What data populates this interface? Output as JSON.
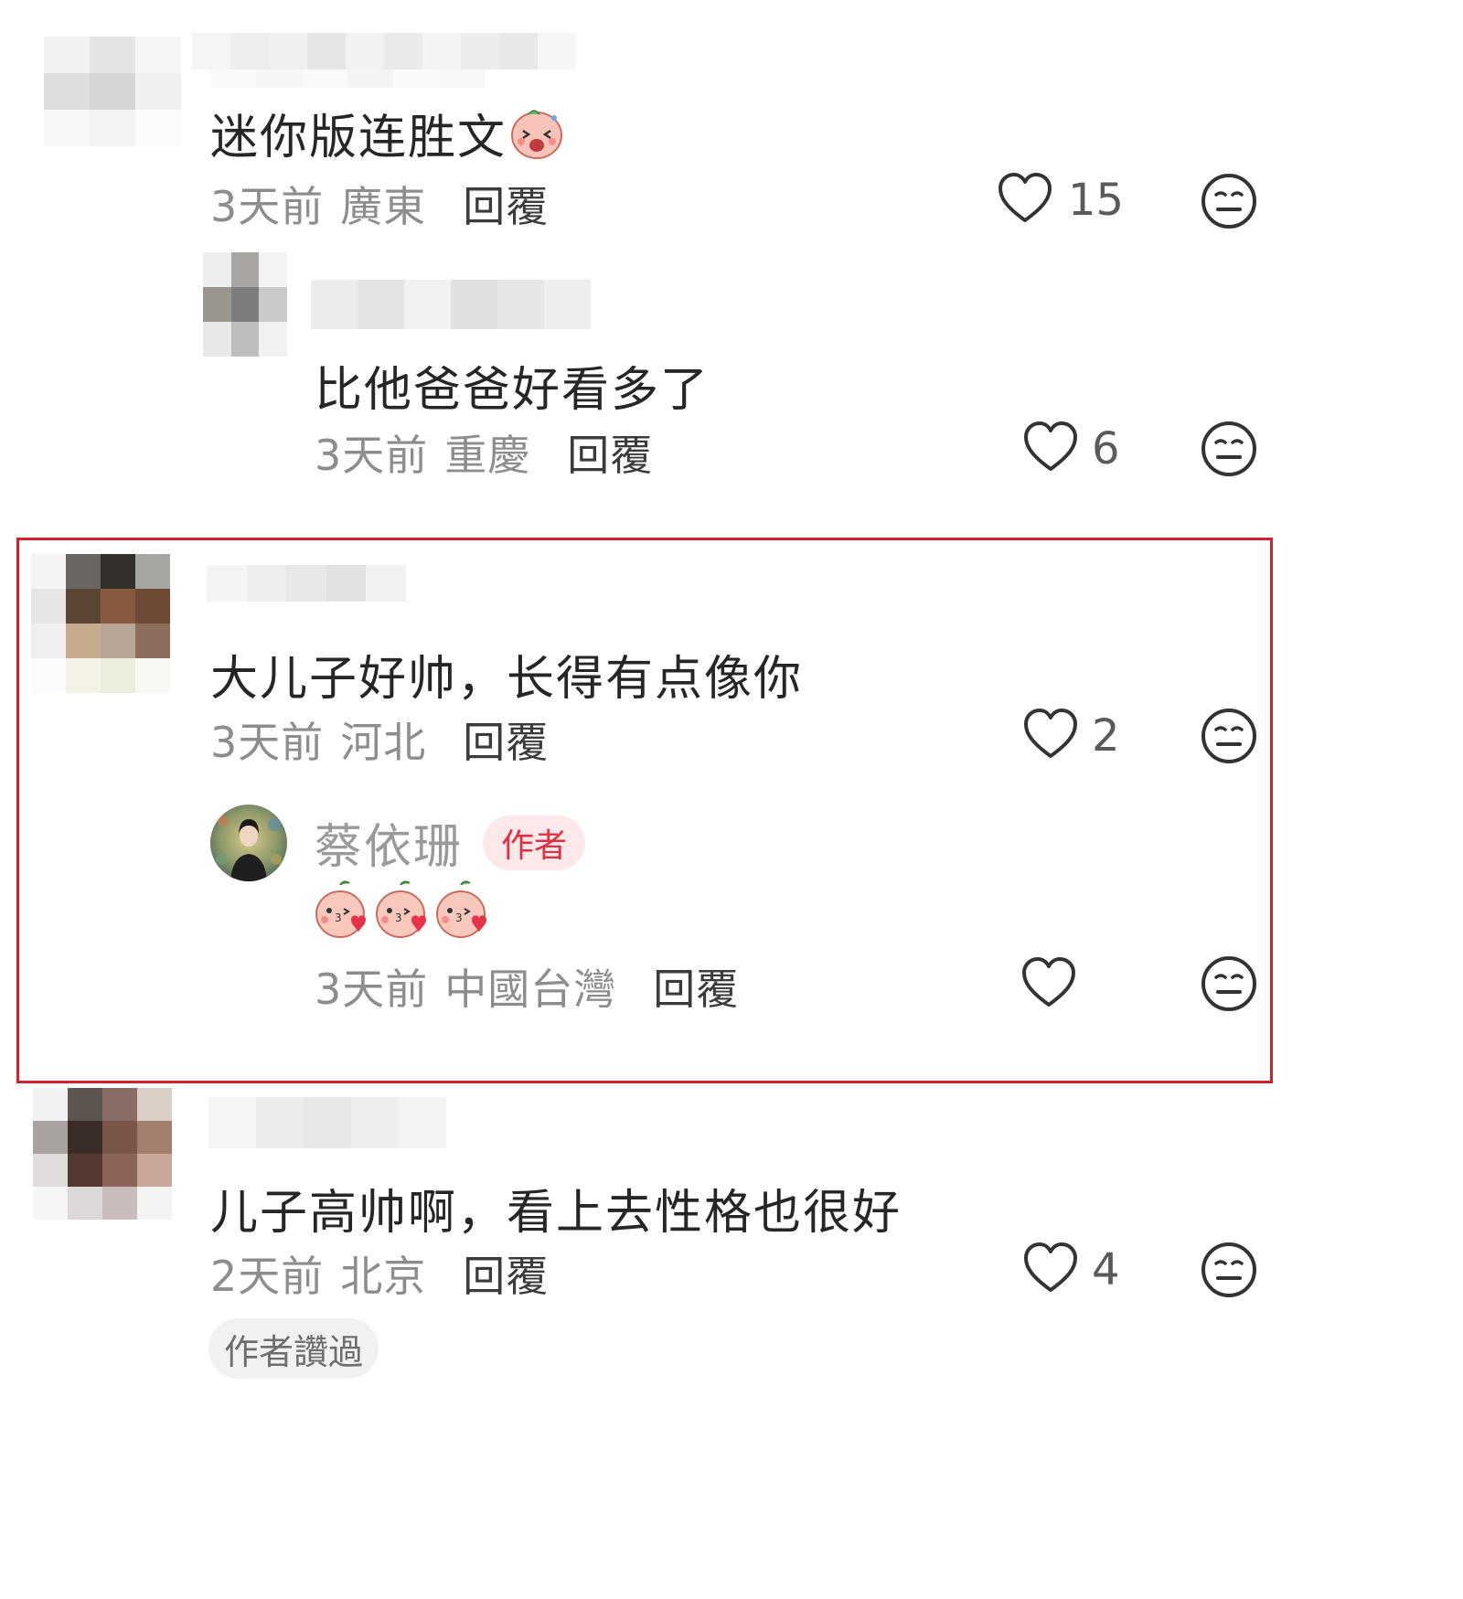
{
  "comments": [
    {
      "text": "迷你版连胜文",
      "time": "3天前",
      "location": "廣東",
      "reply_label": "回覆",
      "likes": "15",
      "avatar_colors": [
        "#f2f2f2",
        "#e4e4e4",
        "#f5f5f5",
        "#dedede",
        "#d6d6d6",
        "#f0f0f0",
        "#f7f7f7",
        "#f3f3f3",
        "#fbfbfb"
      ],
      "emoji": "sticker-blushing-face"
    },
    {
      "text": "比他爸爸好看多了",
      "time": "3天前",
      "location": "重慶",
      "reply_label": "回覆",
      "likes": "6",
      "avatar_colors": [
        "#eeeeee",
        "#a8a5a2",
        "#f3f3f3",
        "#9a958f",
        "#7d7d7d",
        "#c9c9c9",
        "#e8e8e8",
        "#bebebe",
        "#f1f1f1"
      ]
    },
    {
      "text": "大儿子好帅，长得有点像你",
      "time": "3天前",
      "location": "河北",
      "reply_label": "回覆",
      "likes": "2",
      "avatar_colors": [
        "#f4f4f4",
        "#6a6763",
        "#34312d",
        "#a8a6a3",
        "#e5e5e5",
        "#5b4636",
        "#8a5a3c",
        "#6e4a34",
        "#efefef",
        "#c6ab8c",
        "#b9a596",
        "#8c6e5c",
        "#fbfbfb",
        "#f5f3e6",
        "#eceedb",
        "#f8f8f5"
      ],
      "reply": {
        "author": "蔡依珊",
        "badge": "作者",
        "emoji": [
          "sticker-kiss",
          "sticker-kiss",
          "sticker-kiss"
        ],
        "time": "3天前",
        "location": "中國台灣",
        "reply_label": "回覆"
      }
    },
    {
      "text": "儿子高帅啊，看上去性格也很好",
      "time": "2天前",
      "location": "北京",
      "reply_label": "回覆",
      "likes": "4",
      "liked_by_author": "作者讚過",
      "avatar_colors": [
        "#f2f2f2",
        "#5e5450",
        "#8a6e66",
        "#d9cfc6",
        "#a8a3a0",
        "#3a2c27",
        "#7b5549",
        "#a27f6c",
        "#e2dddd",
        "#523a30",
        "#8d6458",
        "#c9a79a",
        "#f6f6f6",
        "#ddd8d8",
        "#c9bcbc",
        "#f4f4f4"
      ]
    }
  ],
  "colors": {
    "highlight_border": "#d1202e",
    "author_badge_bg": "#fde9ea",
    "author_badge_text": "#e0303f",
    "icon_stroke": "#333333"
  },
  "icons": [
    "heart-outline-icon",
    "meh-face-icon"
  ]
}
